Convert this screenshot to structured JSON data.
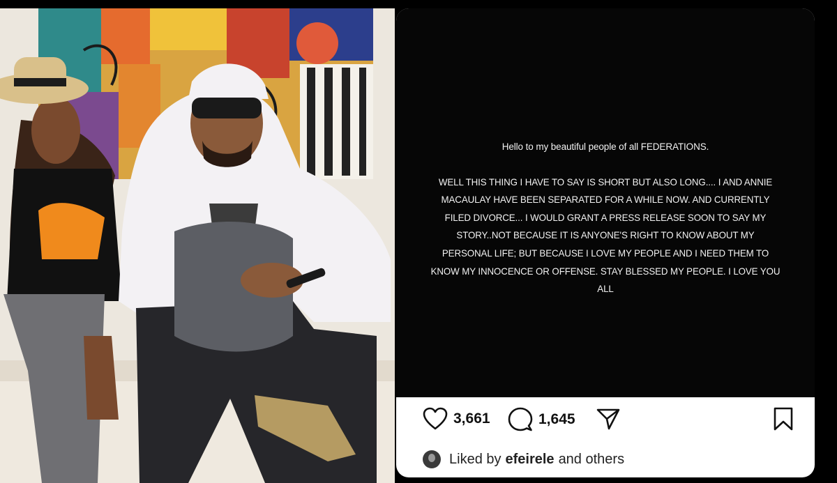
{
  "photo": {
    "alt": "Man in white hoodie and sunglasses seated next to woman in straw hat in front of a colorful painting"
  },
  "story": {
    "greeting": "Hello to my beautiful people of all FEDERATIONS.",
    "lines": [
      "WELL THIS THING I HAVE TO SAY IS SHORT BUT ALSO LONG.... I AND ANNIE",
      "MACAULAY HAVE BEEN SEPARATED FOR A WHILE NOW. AND CURRENTLY",
      "FILED DIVORCE... I WOULD GRANT A PRESS RELEASE SOON TO SAY MY",
      "STORY..NOT BECAUSE IT IS ANYONE'S RIGHT TO KNOW ABOUT MY",
      "PERSONAL LIFE; BUT BECAUSE I LOVE MY PEOPLE AND I NEED THEM TO",
      "KNOW MY INNOCENCE OR OFFENSE. STAY BLESSED MY PEOPLE. I LOVE YOU",
      "ALL"
    ]
  },
  "actions": {
    "like_icon": "heart-icon",
    "like_count": "3,661",
    "comment_icon": "comment-icon",
    "comment_count": "1,645",
    "share_icon": "send-icon",
    "save_icon": "bookmark-icon"
  },
  "liked_by": {
    "prefix": "Liked by",
    "user": "efeirele",
    "suffix": "and others"
  }
}
